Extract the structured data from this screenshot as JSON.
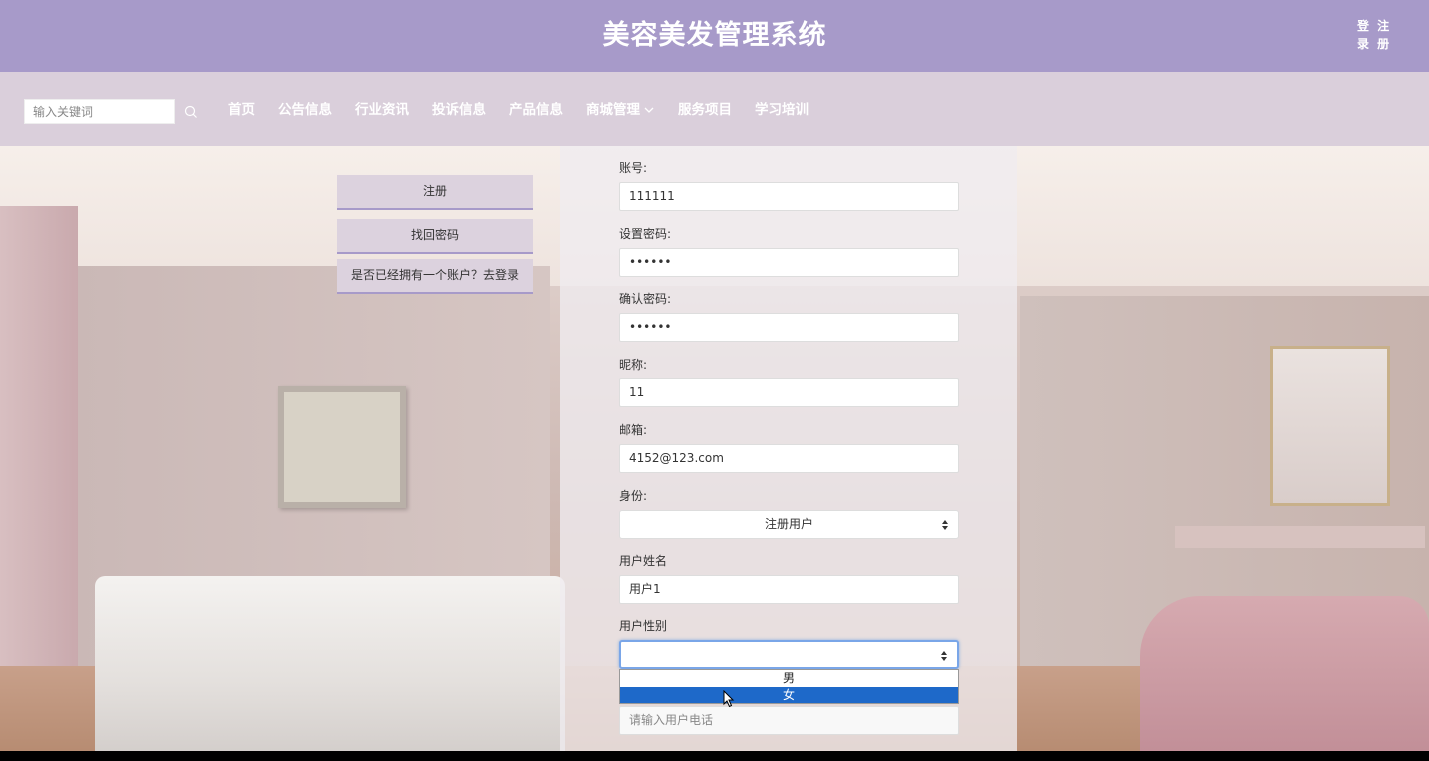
{
  "header": {
    "title": "美容美发管理系统",
    "login": "登录",
    "register": "注册"
  },
  "nav": {
    "search_placeholder": "输入关键词",
    "items": [
      "首页",
      "公告信息",
      "行业资讯",
      "投诉信息",
      "产品信息",
      "商城管理",
      "服务项目",
      "学习培训"
    ]
  },
  "side": {
    "register": "注册",
    "find_password": "找回密码",
    "have_account": "是否已经拥有一个账户？去登录"
  },
  "form": {
    "account_label": "账号:",
    "account_value": "111111",
    "password_label": "设置密码:",
    "password_value": "••••••",
    "confirm_label": "确认密码:",
    "confirm_value": "••••••",
    "nickname_label": "昵称:",
    "nickname_value": "11",
    "email_label": "邮箱:",
    "email_value": "4152@123.com",
    "role_label": "身份:",
    "role_value": "注册用户",
    "name_label": "用户姓名",
    "name_value": "用户1",
    "gender_label": "用户性别",
    "gender_value": "",
    "gender_options": [
      "男",
      "女"
    ],
    "phone_placeholder": "请输入用户电话"
  },
  "colors": {
    "header_bg": "#a79ac9",
    "nav_bg": "#dacfdb",
    "selected_option": "#1e69c9"
  }
}
